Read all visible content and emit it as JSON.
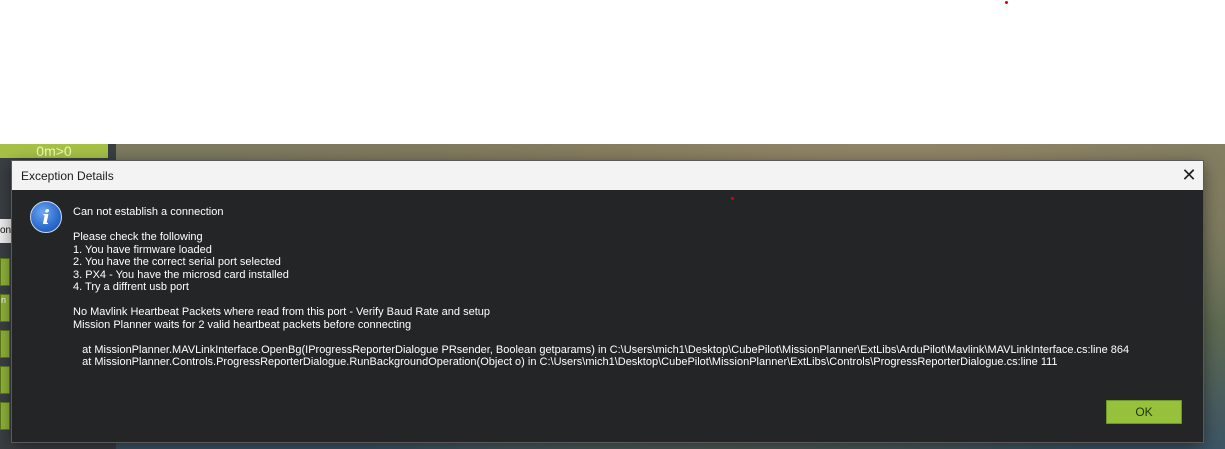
{
  "app": {
    "left_panel_label": "0m>0",
    "left_panel_btn_text": "onc",
    "left_panel_small_text": "n"
  },
  "dialog": {
    "title": "Exception Details",
    "close_glyph": "✕",
    "icon": "info-icon",
    "icon_glyph": "i",
    "heading": "Can not establish a connection",
    "check_title": "Please check the following",
    "checks": [
      "1. You have firmware loaded",
      "2. You have the correct serial port selected",
      "3. PX4 - You have the microsd card installed",
      "4. Try a diffrent usb port"
    ],
    "heartbeat_line1": "No Mavlink Heartbeat Packets where read from this port - Verify Baud Rate and setup",
    "heartbeat_line2": "Mission Planner waits for 2 valid heartbeat packets before connecting",
    "stack_line1": "   at MissionPlanner.MAVLinkInterface.OpenBg(IProgressReporterDialogue PRsender, Boolean getparams) in C:\\Users\\mich1\\Desktop\\CubePilot\\MissionPlanner\\ExtLibs\\ArduPilot\\Mavlink\\MAVLinkInterface.cs:line 864",
    "stack_line2": "   at MissionPlanner.Controls.ProgressReporterDialogue.RunBackgroundOperation(Object o) in C:\\Users\\mich1\\Desktop\\CubePilot\\MissionPlanner\\ExtLibs\\Controls\\ProgressReporterDialogue.cs:line 111",
    "ok_label": "OK"
  },
  "colors": {
    "dialog_bg": "#242526",
    "ok_button": "#95c13b",
    "titlebar": "#f3f3f3"
  }
}
